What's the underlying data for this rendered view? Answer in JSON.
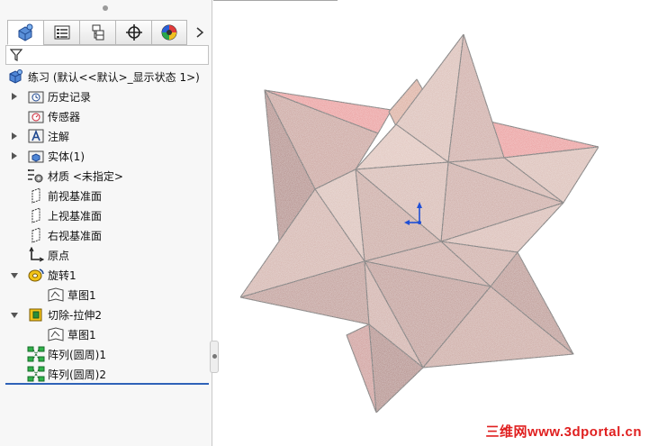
{
  "feature_tree": {
    "root_label": "练习 (默认<<默认>_显示状态 1>)",
    "items": [
      {
        "label": "历史记录",
        "icon": "history-folder-icon",
        "expandable": true
      },
      {
        "label": "传感器",
        "icon": "sensor-icon",
        "expandable": false
      },
      {
        "label": "注解",
        "icon": "annotation-icon",
        "expandable": true
      },
      {
        "label": "实体(1)",
        "icon": "solid-bodies-icon",
        "expandable": true
      },
      {
        "label": "材质 <未指定>",
        "icon": "material-icon",
        "expandable": false
      },
      {
        "label": "前视基准面",
        "icon": "plane-icon",
        "expandable": false
      },
      {
        "label": "上视基准面",
        "icon": "plane-icon",
        "expandable": false
      },
      {
        "label": "右视基准面",
        "icon": "plane-icon",
        "expandable": false
      },
      {
        "label": "原点",
        "icon": "origin-icon",
        "expandable": false
      },
      {
        "label": "旋转1",
        "icon": "revolve-icon",
        "expandable": true,
        "expanded": true
      },
      {
        "label": "草图1",
        "icon": "sketch-icon",
        "child": true
      },
      {
        "label": "切除-拉伸2",
        "icon": "cut-extrude-icon",
        "expandable": true,
        "expanded": true
      },
      {
        "label": "草图1",
        "icon": "sketch-icon",
        "child": true
      },
      {
        "label": "阵列(圆周)1",
        "icon": "circular-pattern-icon",
        "expandable": false
      },
      {
        "label": "阵列(圆周)2",
        "icon": "circular-pattern-icon",
        "expandable": false
      }
    ]
  },
  "tabs": [
    "feature-manager-tab",
    "property-manager-tab",
    "configuration-manager-tab",
    "dimxpert-tab",
    "display-manager-tab"
  ],
  "watermark": "三维网www.3dportal.cn",
  "colors": {
    "face_light": "#d8b8b0",
    "face_mid": "#c89e96",
    "face_dark": "#a97a73",
    "face_red": "#e98d8d",
    "accent_blue": "#1f4fd6"
  }
}
